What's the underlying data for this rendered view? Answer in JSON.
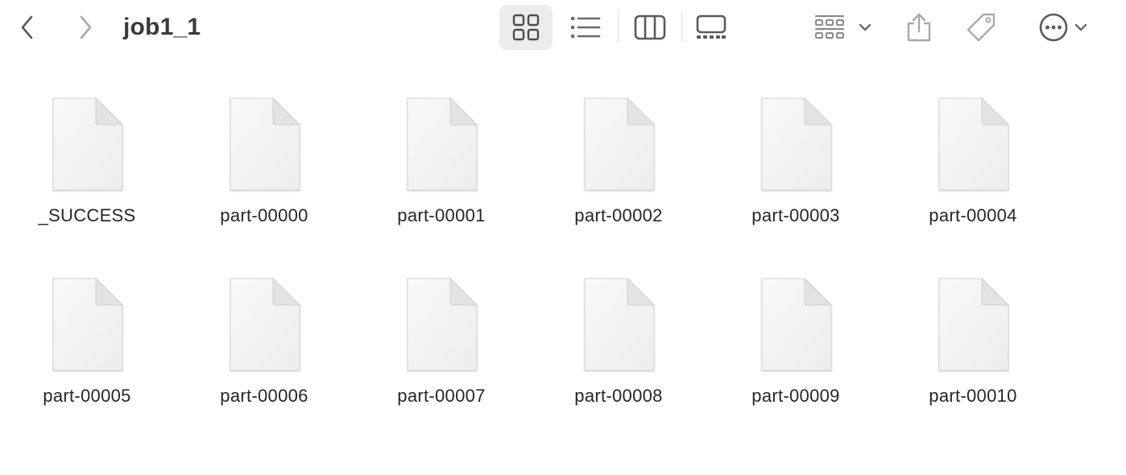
{
  "window": {
    "title": "job1_1"
  },
  "toolbar": {
    "back_icon": "chevron-left-icon",
    "forward_icon": "chevron-right-icon",
    "view_modes": [
      {
        "name": "icon-view",
        "icon": "grid-icon",
        "selected": true
      },
      {
        "name": "list-view",
        "icon": "list-icon",
        "selected": false
      },
      {
        "name": "column-view",
        "icon": "columns-icon",
        "selected": false
      },
      {
        "name": "gallery-view",
        "icon": "gallery-icon",
        "selected": false
      }
    ],
    "group_icon": "group-by-icon",
    "share_icon": "share-icon",
    "tag_icon": "tag-icon",
    "more_icon": "ellipsis-circle-icon"
  },
  "files": [
    {
      "name": "_SUCCESS"
    },
    {
      "name": "part-00000"
    },
    {
      "name": "part-00001"
    },
    {
      "name": "part-00002"
    },
    {
      "name": "part-00003"
    },
    {
      "name": "part-00004"
    },
    {
      "name": "part-00005"
    },
    {
      "name": "part-00006"
    },
    {
      "name": "part-00007"
    },
    {
      "name": "part-00008"
    },
    {
      "name": "part-00009"
    },
    {
      "name": "part-00010"
    }
  ],
  "colors": {
    "toolbar_icon": "#8e8e8e",
    "toolbar_icon_dark": "#4d4d4d",
    "selected_bg": "#ececec",
    "file_fill": "#f4f4f4",
    "file_stroke": "#d6d6d6"
  }
}
